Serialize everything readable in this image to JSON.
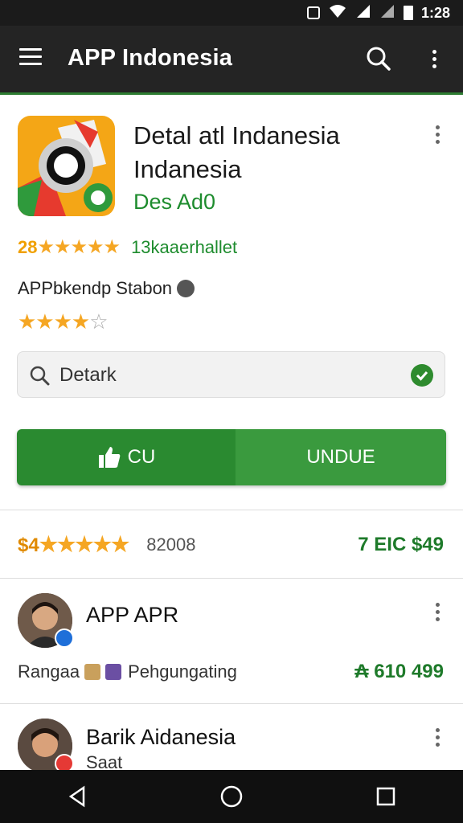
{
  "status_bar": {
    "time": "1:28"
  },
  "app_bar": {
    "title": "APP Indonesia"
  },
  "app": {
    "title": "Detal atl Indanesia Indanesia",
    "developer": "Des Ad0",
    "rating_value": "28",
    "rating_stars": "★★★★★",
    "reviews": "13kaaerhallet",
    "meta_text": "APPbkendp Stabon",
    "user_stars_on": "★★★★",
    "user_stars_off": "☆"
  },
  "search": {
    "value": "Detark",
    "placeholder": "Detark"
  },
  "actions": {
    "like_label": "CU",
    "download_label": "UNDUE"
  },
  "price_row": {
    "left": "$4",
    "stars": "★★★★★",
    "count": "82008",
    "right": "7 EIC $49"
  },
  "list": [
    {
      "title": "APP APR",
      "sub_left": "Rangaa",
      "sub_mid": "Pehgungating",
      "sub_right": "₳ 610 499"
    },
    {
      "title": "Barik Aidanesia",
      "sub": "Saat"
    }
  ],
  "colors": {
    "accent": "#2e8b2e",
    "star": "#f5a623",
    "appbar": "#242424"
  }
}
